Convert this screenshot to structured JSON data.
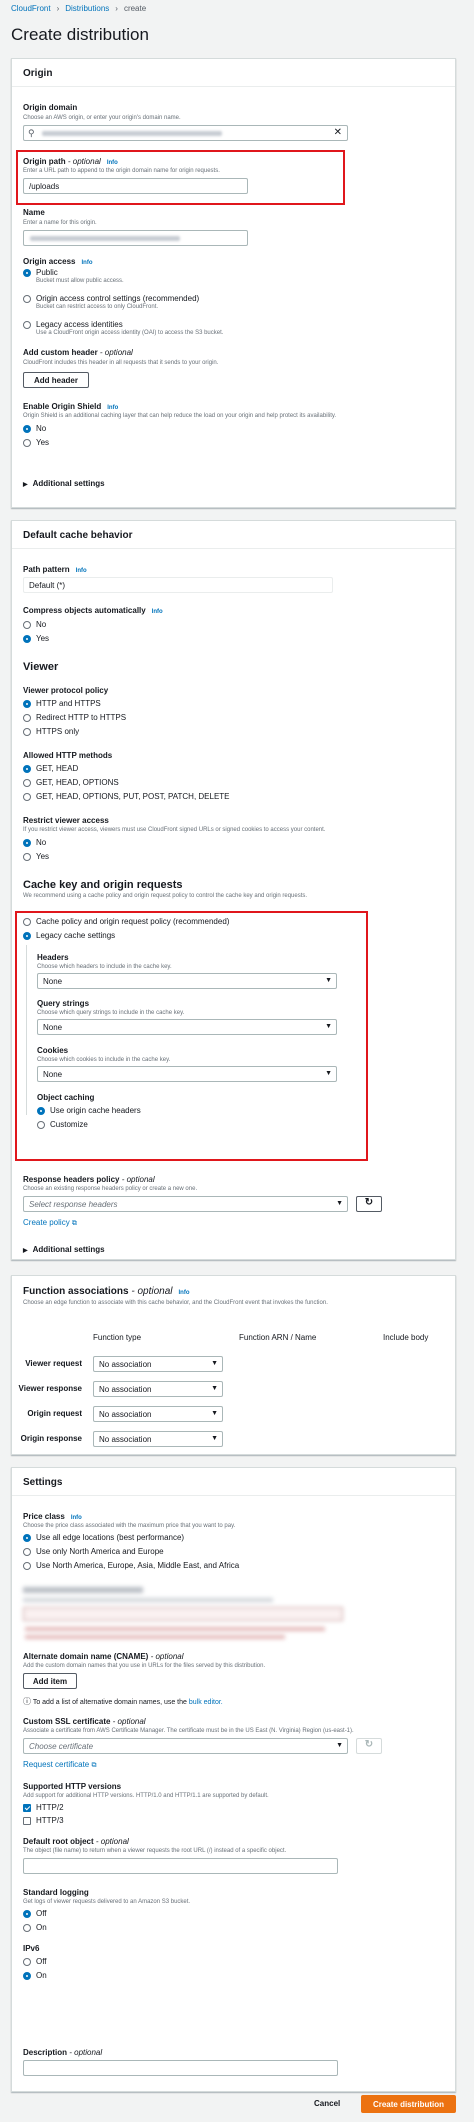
{
  "breadcrumb": {
    "items": [
      "CloudFront",
      "Distributions",
      "create"
    ]
  },
  "page_title": "Create distribution",
  "origin": {
    "title": "Origin",
    "domain": {
      "label": "Origin domain",
      "desc": "Choose an AWS origin, or enter your origin's domain name."
    },
    "path": {
      "label": "Origin path",
      "optional": " - optional",
      "info": "Info",
      "desc": "Enter a URL path to append to the origin domain name for origin requests.",
      "value": "/uploads"
    },
    "name": {
      "label": "Name",
      "desc": "Enter a name for this origin."
    },
    "access": {
      "label": "Origin access",
      "info": "Info",
      "options": [
        {
          "label": "Public",
          "desc": "Bucket must allow public access."
        },
        {
          "label": "Origin access control settings (recommended)",
          "desc": "Bucket can restrict access to only CloudFront."
        },
        {
          "label": "Legacy access identities",
          "desc": "Use a CloudFront origin access identity (OAI) to access the S3 bucket."
        }
      ]
    },
    "custom_header": {
      "label": "Add custom header",
      "optional": " - optional",
      "desc": "CloudFront includes this header in all requests that it sends to your origin.",
      "button": "Add header"
    },
    "shield": {
      "label": "Enable Origin Shield",
      "info": "Info",
      "desc": "Origin Shield is an additional caching layer that can help reduce the load on your origin and help protect its availability.",
      "options": [
        "No",
        "Yes"
      ]
    },
    "additional": "Additional settings"
  },
  "cache_behavior": {
    "title": "Default cache behavior",
    "path_pattern": {
      "label": "Path pattern",
      "info": "Info",
      "value": "Default (*)"
    },
    "compress": {
      "label": "Compress objects automatically",
      "info": "Info",
      "options": [
        "No",
        "Yes"
      ]
    },
    "viewer": {
      "heading": "Viewer",
      "protocol": {
        "label": "Viewer protocol policy",
        "options": [
          "HTTP and HTTPS",
          "Redirect HTTP to HTTPS",
          "HTTPS only"
        ]
      },
      "methods": {
        "label": "Allowed HTTP methods",
        "options": [
          "GET, HEAD",
          "GET, HEAD, OPTIONS",
          "GET, HEAD, OPTIONS, PUT, POST, PATCH, DELETE"
        ]
      },
      "restrict": {
        "label": "Restrict viewer access",
        "desc": "If you restrict viewer access, viewers must use CloudFront signed URLs or signed cookies to access your content.",
        "options": [
          "No",
          "Yes"
        ]
      }
    },
    "cache_key": {
      "heading": "Cache key and origin requests",
      "desc": "We recommend using a cache policy and origin request policy to control the cache key and origin requests.",
      "options": [
        "Cache policy and origin request policy (recommended)",
        "Legacy cache settings"
      ],
      "headers": {
        "label": "Headers",
        "desc": "Choose which headers to include in the cache key.",
        "value": "None"
      },
      "query": {
        "label": "Query strings",
        "desc": "Choose which query strings to include in the cache key.",
        "value": "None"
      },
      "cookies": {
        "label": "Cookies",
        "desc": "Choose which cookies to include in the cache key.",
        "value": "None"
      },
      "object_caching": {
        "label": "Object caching",
        "options": [
          "Use origin cache headers",
          "Customize"
        ]
      }
    },
    "response_headers": {
      "label": "Response headers policy",
      "optional": " - optional",
      "desc": "Choose an existing response headers policy or create a new one.",
      "placeholder": "Select response headers",
      "create": "Create policy"
    },
    "additional": "Additional settings"
  },
  "functions": {
    "title": "Function associations",
    "optional": " - optional",
    "info": "Info",
    "desc": "Choose an edge function to associate with this cache behavior, and the CloudFront event that invokes the function.",
    "columns": [
      "Function type",
      "Function ARN / Name",
      "Include body"
    ],
    "rows": [
      {
        "label": "Viewer request",
        "value": "No association"
      },
      {
        "label": "Viewer response",
        "value": "No association"
      },
      {
        "label": "Origin request",
        "value": "No association"
      },
      {
        "label": "Origin response",
        "value": "No association"
      }
    ]
  },
  "settings": {
    "title": "Settings",
    "price": {
      "label": "Price class",
      "info": "Info",
      "desc": "Choose the price class associated with the maximum price that you want to pay.",
      "options": [
        "Use all edge locations (best performance)",
        "Use only North America and Europe",
        "Use North America, Europe, Asia, Middle East, and Africa"
      ]
    },
    "cname": {
      "label": "Alternate domain name (CNAME)",
      "optional": " - optional",
      "desc": "Add the custom domain names that you use in URLs for the files served by this distribution.",
      "button": "Add item",
      "note": "To add a list of alternative domain names, use the ",
      "note_link": "bulk editor."
    },
    "ssl": {
      "label": "Custom SSL certificate",
      "optional": " - optional",
      "desc": "Associate a certificate from AWS Certificate Manager. The certificate must be in the US East (N. Virginia) Region (us-east-1).",
      "placeholder": "Choose certificate",
      "request": "Request certificate"
    },
    "http_versions": {
      "label": "Supported HTTP versions",
      "desc": "Add support for additional HTTP versions. HTTP/1.0 and HTTP/1.1 are supported by default.",
      "options": [
        "HTTP/2",
        "HTTP/3"
      ]
    },
    "root_object": {
      "label": "Default root object",
      "optional": " - optional",
      "desc": "The object (file name) to return when a viewer requests the root URL (/) instead of a specific object."
    },
    "logging": {
      "label": "Standard logging",
      "desc": "Get logs of viewer requests delivered to an Amazon S3 bucket.",
      "options": [
        "Off",
        "On"
      ]
    },
    "ipv6": {
      "label": "IPv6",
      "options": [
        "Off",
        "On"
      ]
    },
    "description": {
      "label": "Description",
      "optional": " - optional"
    }
  },
  "footer": {
    "cancel": "Cancel",
    "create": "Create distribution"
  },
  "colors": {
    "accent": "#0073bb",
    "primary": "#ec7211",
    "highlight": "#e0171c"
  }
}
